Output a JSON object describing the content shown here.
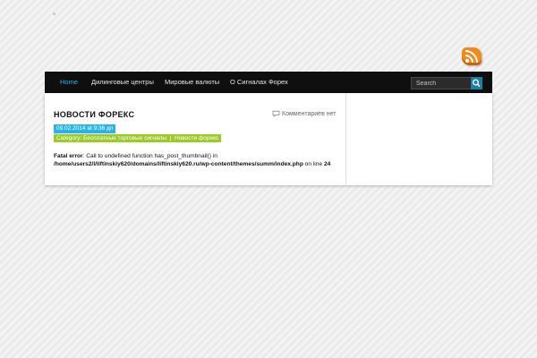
{
  "nav": {
    "items": [
      {
        "label": "Home",
        "active": true
      },
      {
        "label": "Дилинговые центры",
        "active": false
      },
      {
        "label": "Мировые валюты",
        "active": false
      },
      {
        "label": "О Сигналах Форех",
        "active": false
      }
    ],
    "search_placeholder": "Search"
  },
  "post": {
    "title": "НОВОСТИ ФОРЕКС",
    "comments": "Комментариев нет",
    "date": "09.02.2014 at 9:36 дп",
    "category_prefix": "Category:",
    "categories": [
      "Бесплатные торговые сигналы",
      "Новости форекс"
    ],
    "category_separator": "|",
    "error": {
      "label": "Fatal error",
      "message": ": Call to undefined function has_post_thumbnail() in",
      "path": "/home/users2/l/liftinskiy620/domains/liftinskiy620.ru/wp-content/themes/summ/index.php",
      "on_line_text": " on line ",
      "line": "24"
    }
  },
  "colors": {
    "accent_blue": "#27b5e8",
    "accent_green": "#9bcb27",
    "nav_bg": "#0f0f0f",
    "rss_orange": "#f08a1c"
  },
  "icons": [
    "rss-icon",
    "search-icon",
    "comment-bubble-icon"
  ]
}
